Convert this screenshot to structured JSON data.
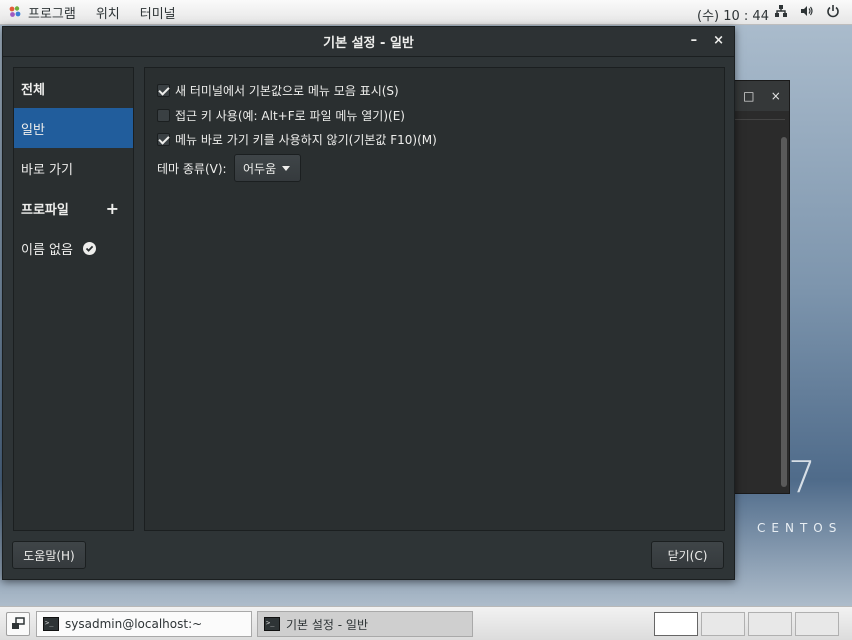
{
  "topbar": {
    "menu": [
      "프로그램",
      "위치",
      "터미널"
    ],
    "clock": "(수) 10 : 44"
  },
  "background": {
    "brand": "CENTOS",
    "version_mark": "7"
  },
  "dialog": {
    "title": "기본 설정 - 일반",
    "minimize": "–",
    "close": "×",
    "sidebar": {
      "items": [
        {
          "label": "전체",
          "kind": "header"
        },
        {
          "label": "일반",
          "kind": "item",
          "selected": true
        },
        {
          "label": "바로 가기",
          "kind": "item"
        },
        {
          "label": "프로파일",
          "kind": "header",
          "action": "+"
        },
        {
          "label": "이름 없음",
          "kind": "item",
          "default": true
        }
      ]
    },
    "options": [
      {
        "label": "새 터미널에서 기본값으로 메뉴 모음 표시(S)",
        "checked": true
      },
      {
        "label": "접근 키 사용(예: Alt+F로 파일 메뉴 열기)(E)",
        "checked": false
      },
      {
        "label": "메뉴 바로 가기 키를 사용하지 않기(기본값 F10)(M)",
        "checked": true
      }
    ],
    "theme": {
      "label": "테마 종류(V):",
      "value": "어두움"
    },
    "buttons": {
      "help": "도움말(H)",
      "close": "닫기(C)"
    }
  },
  "bg_window": {
    "maximize": "□",
    "close": "×"
  },
  "taskbar": {
    "tasks": [
      {
        "label": "sysadmin@localhost:~",
        "active": false
      },
      {
        "label": "기본 설정 - 일반",
        "active": true
      }
    ],
    "workspaces": 4,
    "active_workspace": 1
  }
}
